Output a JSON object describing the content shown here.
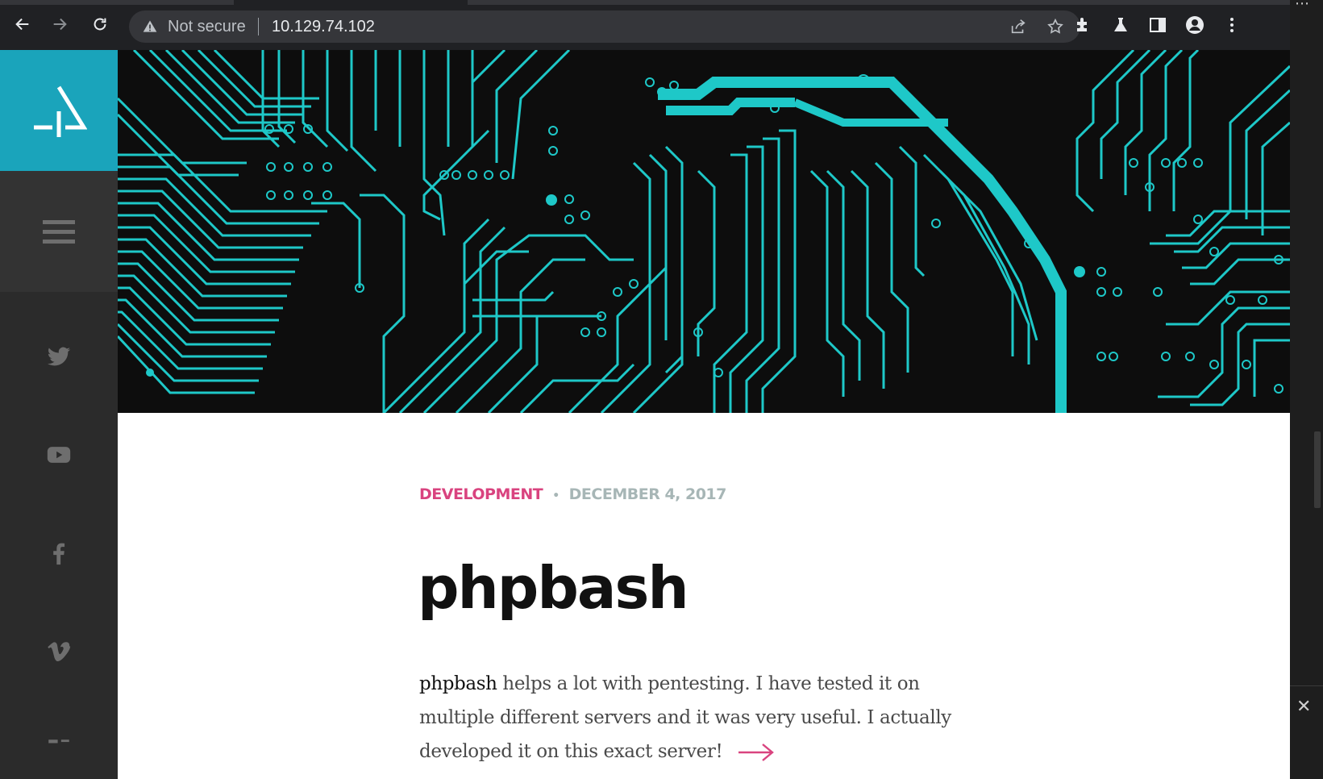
{
  "browser": {
    "security_label": "Not secure",
    "url": "10.129.74.102",
    "icons": {
      "back": "back-arrow-icon",
      "forward": "forward-arrow-icon",
      "reload": "reload-icon",
      "warning": "warning-triangle-icon",
      "share": "share-icon",
      "bookmark": "star-icon",
      "extensions": "puzzle-icon",
      "labs": "flask-icon",
      "side_panel": "side-panel-icon",
      "profile": "profile-icon",
      "menu": "kebab-menu-icon"
    }
  },
  "sidebar": {
    "accent_color": "#1aa4bb",
    "social": [
      "twitter-icon",
      "youtube-icon",
      "facebook-icon",
      "vimeo-icon",
      "behance-icon"
    ]
  },
  "hero": {
    "trace_color": "#1ec8c8",
    "background_color": "#0d0d0d"
  },
  "article": {
    "category": "DEVELOPMENT",
    "separator": "•",
    "date": "DECEMBER 4, 2017",
    "title": "phpbash",
    "excerpt_strong": "phpbash",
    "excerpt_rest": " helps a lot with pentesting. I have tested it on multiple different servers and it was very useful. I actually developed it on this exact server!",
    "accent_color": "#d9437f"
  }
}
